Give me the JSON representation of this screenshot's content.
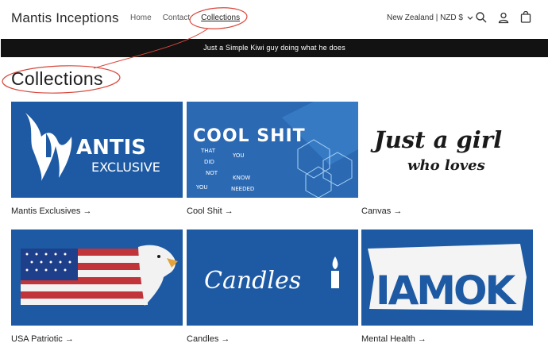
{
  "header": {
    "logo": "Mantis Inceptions",
    "nav": [
      {
        "label": "Home"
      },
      {
        "label": "Contact"
      },
      {
        "label": "Collections"
      }
    ],
    "region": "New Zealand | NZD $"
  },
  "banner": {
    "text": "Just a Simple Kiwi guy doing what he does"
  },
  "page_title": "Collections",
  "collections": [
    {
      "label": "Mantis Exclusives →",
      "art": {
        "line1": "ANTIS",
        "line2": "EXCLUSIVE"
      }
    },
    {
      "label": "Cool Shit →",
      "art": {
        "title": "COOL SHIT",
        "w1": "THAT",
        "w2": "YOU",
        "w3": "DID",
        "w4": "NOT",
        "w5": "KNOW",
        "w6": "YOU",
        "w7": "NEEDED"
      }
    },
    {
      "label": "Canvas →",
      "art": {
        "line1": "Just a girl",
        "line2": "who loves"
      }
    },
    {
      "label": "USA Patriotic →"
    },
    {
      "label": "Candles →",
      "art": {
        "word": "Candles"
      }
    },
    {
      "label": "Mental Health →",
      "art": {
        "text": "IAMOK"
      }
    }
  ],
  "colors": {
    "tile_blue": "#1d5aa3",
    "banner_bg": "#121212",
    "annotation_red": "#d9463a"
  }
}
